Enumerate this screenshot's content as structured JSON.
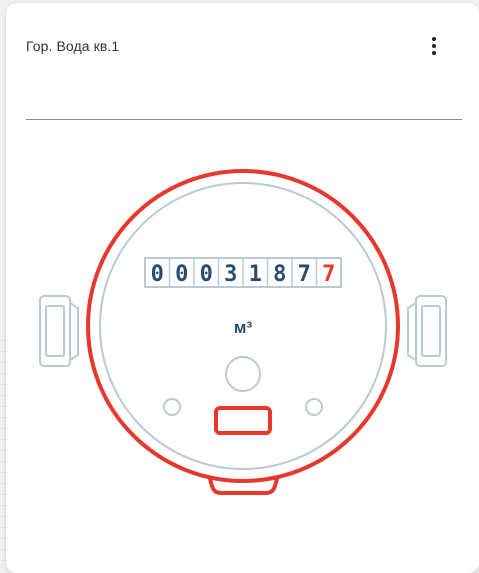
{
  "card": {
    "title": "Гор. Вода кв.1"
  },
  "meter": {
    "digits": [
      "0",
      "0",
      "0",
      "3",
      "1",
      "8",
      "7",
      "7"
    ],
    "unit": "м³",
    "colors": {
      "ring": "#e8372c",
      "outline": "#b8cad6",
      "digit": "#2a4d6e",
      "last_digit": "#e8372c"
    }
  }
}
